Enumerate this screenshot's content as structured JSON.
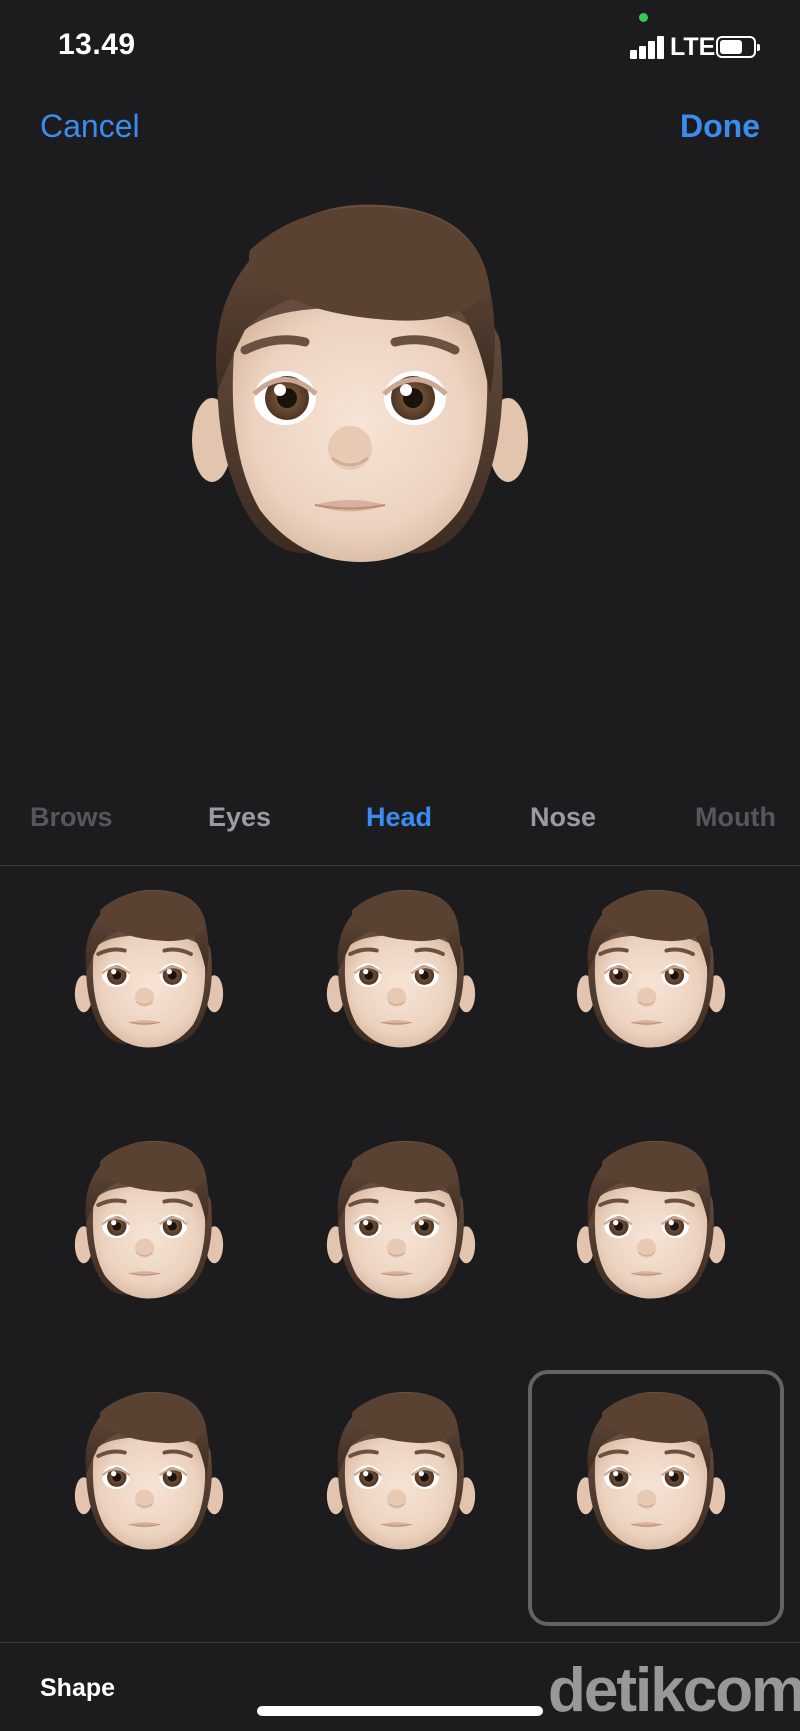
{
  "status_bar": {
    "time": "13.49",
    "network": "LTE"
  },
  "nav": {
    "cancel_label": "Cancel",
    "done_label": "Done"
  },
  "tabs": [
    {
      "label": "Brows",
      "active": false
    },
    {
      "label": "Eyes",
      "active": false
    },
    {
      "label": "Head",
      "active": true
    },
    {
      "label": "Nose",
      "active": false
    },
    {
      "label": "Mouth",
      "active": false
    }
  ],
  "head_options": [
    {
      "row": 1,
      "col": 1,
      "selected": false
    },
    {
      "row": 1,
      "col": 2,
      "selected": false
    },
    {
      "row": 1,
      "col": 3,
      "selected": false
    },
    {
      "row": 2,
      "col": 1,
      "selected": false
    },
    {
      "row": 2,
      "col": 2,
      "selected": false
    },
    {
      "row": 2,
      "col": 3,
      "selected": false
    },
    {
      "row": 3,
      "col": 1,
      "selected": false
    },
    {
      "row": 3,
      "col": 2,
      "selected": false
    },
    {
      "row": 3,
      "col": 3,
      "selected": true
    }
  ],
  "section_label": "Shape",
  "watermark": "detikcom",
  "colors": {
    "accent": "#3b8cf0",
    "background": "#1c1c1e",
    "hair": "#4f3a2e",
    "skin": "#ecd3c0"
  }
}
